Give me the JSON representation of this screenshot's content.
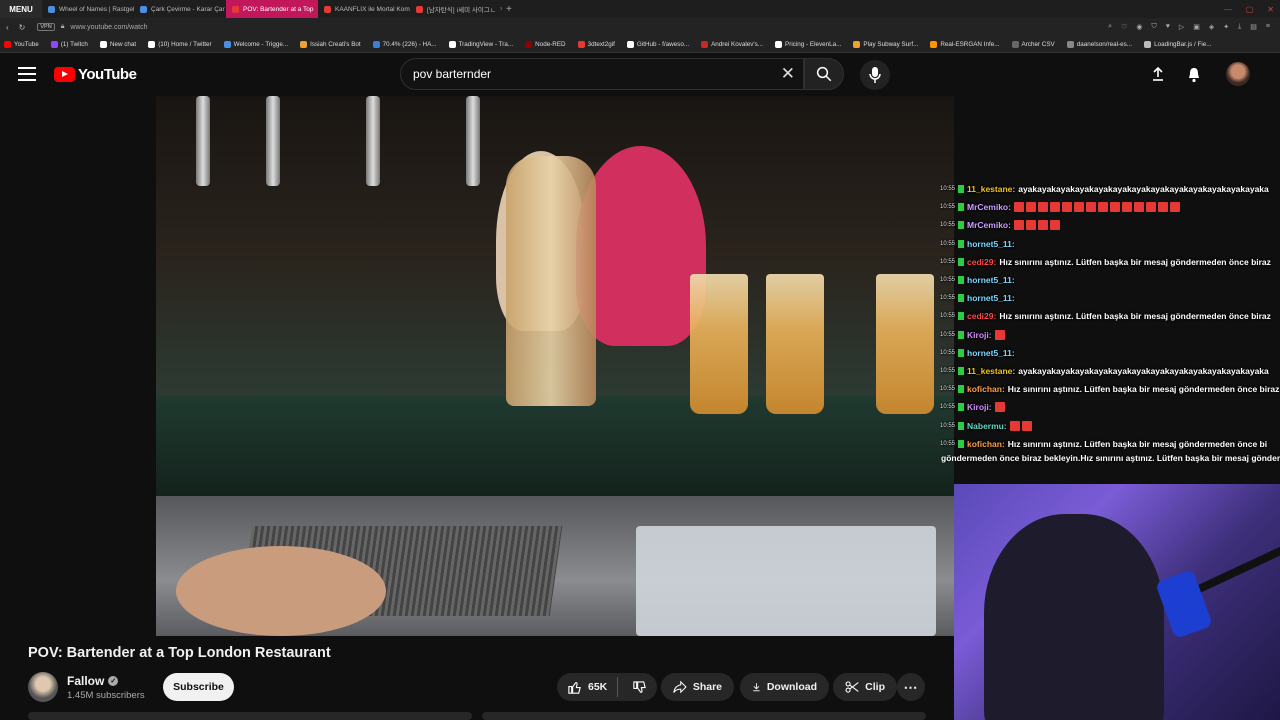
{
  "browser": {
    "menu_label": "MENU",
    "tabs": [
      {
        "label": "Wheel of Names | Rastgel"
      },
      {
        "label": "Çark Çevirme - Karar Çar"
      },
      {
        "label": "POV: Bartender at a Top"
      },
      {
        "label": "KAANFLIX ile Mortal Kom"
      },
      {
        "label": "[남자탄식] ⅰ세미 사이그ㄴ"
      }
    ],
    "url": "www.youtube.com/watch",
    "vpn_label": "VPN",
    "bookmarks": [
      {
        "label": "YouTube",
        "color": "#ff0000"
      },
      {
        "label": "(1) Twitch",
        "color": "#9146ff"
      },
      {
        "label": "New chat",
        "color": "#ffffff"
      },
      {
        "label": "(10) Home / Twitter",
        "color": "#ffffff"
      },
      {
        "label": "Welcome - Trigge...",
        "color": "#4a90e2"
      },
      {
        "label": "Issiah Creati's Bot",
        "color": "#f0a030"
      },
      {
        "label": "70.4% (226) - HA...",
        "color": "#3b7dd8"
      },
      {
        "label": "TradingView - Tra...",
        "color": "#ffffff"
      },
      {
        "label": "Node-RED",
        "color": "#8f0000"
      },
      {
        "label": "3dtext2gif",
        "color": "#e53935"
      },
      {
        "label": "GitHub - f/aweso...",
        "color": "#ffffff"
      },
      {
        "label": "Andrei Kovalev's...",
        "color": "#c62828"
      },
      {
        "label": "Pricing - ElevenLa...",
        "color": "#ffffff"
      },
      {
        "label": "Play Subway Surf...",
        "color": "#f0a030"
      },
      {
        "label": "Real-ESRGAN Infe...",
        "color": "#ff9800"
      },
      {
        "label": "Archer CSV",
        "color": "#666666"
      },
      {
        "label": "daanelson/real-es...",
        "color": "#888888"
      },
      {
        "label": "LoadingBar.js / Fie...",
        "color": "#bbbbbb"
      }
    ]
  },
  "youtube": {
    "logo_text": "YouTube",
    "search_value": "pov barternder",
    "chat": [
      {
        "time": "10:55",
        "user": "11_kestane:",
        "user_color": "#f0c419",
        "msg": "ayakayakayakayakayakayakayakayakayakayakayakayakayaka",
        "emotes": 0
      },
      {
        "time": "10:55",
        "user": "MrCemiko:",
        "user_color": "#c9a0ff",
        "msg": "",
        "emotes": 14
      },
      {
        "time": "10:55",
        "user": "MrCemiko:",
        "user_color": "#c9a0ff",
        "msg": "",
        "emotes": 4
      },
      {
        "time": "10:55",
        "user": "hornet5_11:",
        "user_color": "#7fd6ff",
        "msg": "",
        "emotes": 0
      },
      {
        "time": "10:55",
        "user": "cedi29:",
        "user_color": "#ff4a4a",
        "msg": "Hız sınırını aştınız. Lütfen başka bir mesaj göndermeden önce biraz",
        "emotes": 0
      },
      {
        "time": "10:55",
        "user": "hornet5_11:",
        "user_color": "#7fd6ff",
        "msg": "",
        "emotes": 0
      },
      {
        "time": "10:55",
        "user": "hornet5_11:",
        "user_color": "#7fd6ff",
        "msg": "",
        "emotes": 0
      },
      {
        "time": "10:55",
        "user": "cedi29:",
        "user_color": "#ff4a4a",
        "msg": "Hız sınırını aştınız. Lütfen başka bir mesaj göndermeden önce biraz",
        "emotes": 0
      },
      {
        "time": "10:55",
        "user": "Kiroji:",
        "user_color": "#d58cff",
        "msg": "",
        "emotes": 1
      },
      {
        "time": "10:55",
        "user": "hornet5_11:",
        "user_color": "#7fd6ff",
        "msg": "",
        "emotes": 0
      },
      {
        "time": "10:55",
        "user": "11_kestane:",
        "user_color": "#f0c419",
        "msg": "ayakayakayakayakayakayakayakayakayakayakayakayakayaka",
        "emotes": 0
      },
      {
        "time": "10:55",
        "user": "kofichan:",
        "user_color": "#ff9f43",
        "msg": "Hız sınırını aştınız. Lütfen başka bir mesaj göndermeden önce biraz",
        "emotes": 0
      },
      {
        "time": "10:55",
        "user": "Kiroji:",
        "user_color": "#d58cff",
        "msg": "",
        "emotes": 1
      },
      {
        "time": "10:55",
        "user": "Nabermu:",
        "user_color": "#63d4c4",
        "msg": "",
        "emotes": 2
      },
      {
        "time": "10:55",
        "user": "kofichan:",
        "user_color": "#ff9f43",
        "msg": "Hız sınırını aştınız. Lütfen başka bir mesaj göndermeden önce bi",
        "emotes": 0
      }
    ],
    "chat_continuation": "göndermeden önce biraz bekleyin.Hız sınırını aştınız. Lütfen başka bir mesaj göndermeden",
    "video_title": "POV: Bartender at a Top London Restaurant",
    "channel_name": "Fallow",
    "subscribers": "1.45M subscribers",
    "subscribe_label": "Subscribe",
    "like_count": "65K",
    "share_label": "Share",
    "download_label": "Download",
    "clip_label": "Clip"
  }
}
